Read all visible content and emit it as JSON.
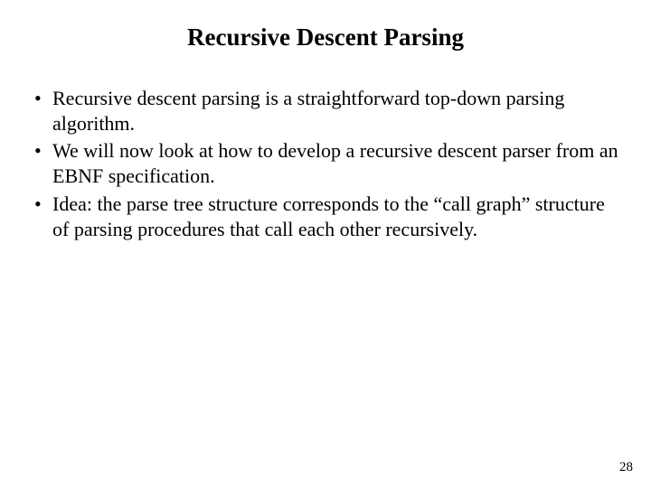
{
  "title": "Recursive Descent Parsing",
  "bullets": [
    "Recursive descent parsing is a straightforward top-down parsing algorithm.",
    "We will now look at how to develop a recursive descent parser from an EBNF specification.",
    "Idea: the parse tree structure corresponds to the “call graph” structure of parsing procedures that call each other recursively."
  ],
  "page_number": "28"
}
